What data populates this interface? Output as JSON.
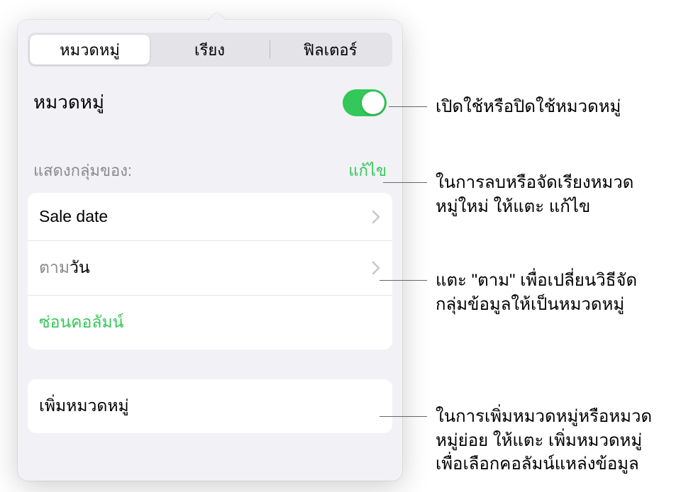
{
  "tabs": {
    "categories": "หมวดหมู่",
    "sort": "เรียง",
    "filter": "ฟิลเตอร์"
  },
  "header": {
    "title": "หมวดหมู่"
  },
  "groups": {
    "label": "แสดงกลุ่มของ:",
    "edit": "แก้ไข",
    "rows": {
      "source": "Sale date",
      "by_prefix": "ตาม",
      "by_value": "วัน",
      "hide_column": "ซ่อนคอลัมน์"
    }
  },
  "add": {
    "label": "เพิ่มหมวดหมู่"
  },
  "callouts": {
    "c1": "เปิดใช้หรือปิดใช้หมวดหมู่",
    "c2a": "ในการลบหรือจัดเรียงหมวด",
    "c2b": "หมู่ใหม่ ให้แตะ แก้ไข",
    "c3a": "แตะ \"ตาม\" เพื่อเปลี่ยนวิธีจัด",
    "c3b": "กลุ่มข้อมูลให้เป็นหมวดหมู่",
    "c4a": "ในการเพิ่มหมวดหมู่หรือหมวด",
    "c4b": "หมู่ย่อย ให้แตะ เพิ่มหมวดหมู่",
    "c4c": "เพื่อเลือกคอลัมน์แหล่งข้อมูล"
  }
}
